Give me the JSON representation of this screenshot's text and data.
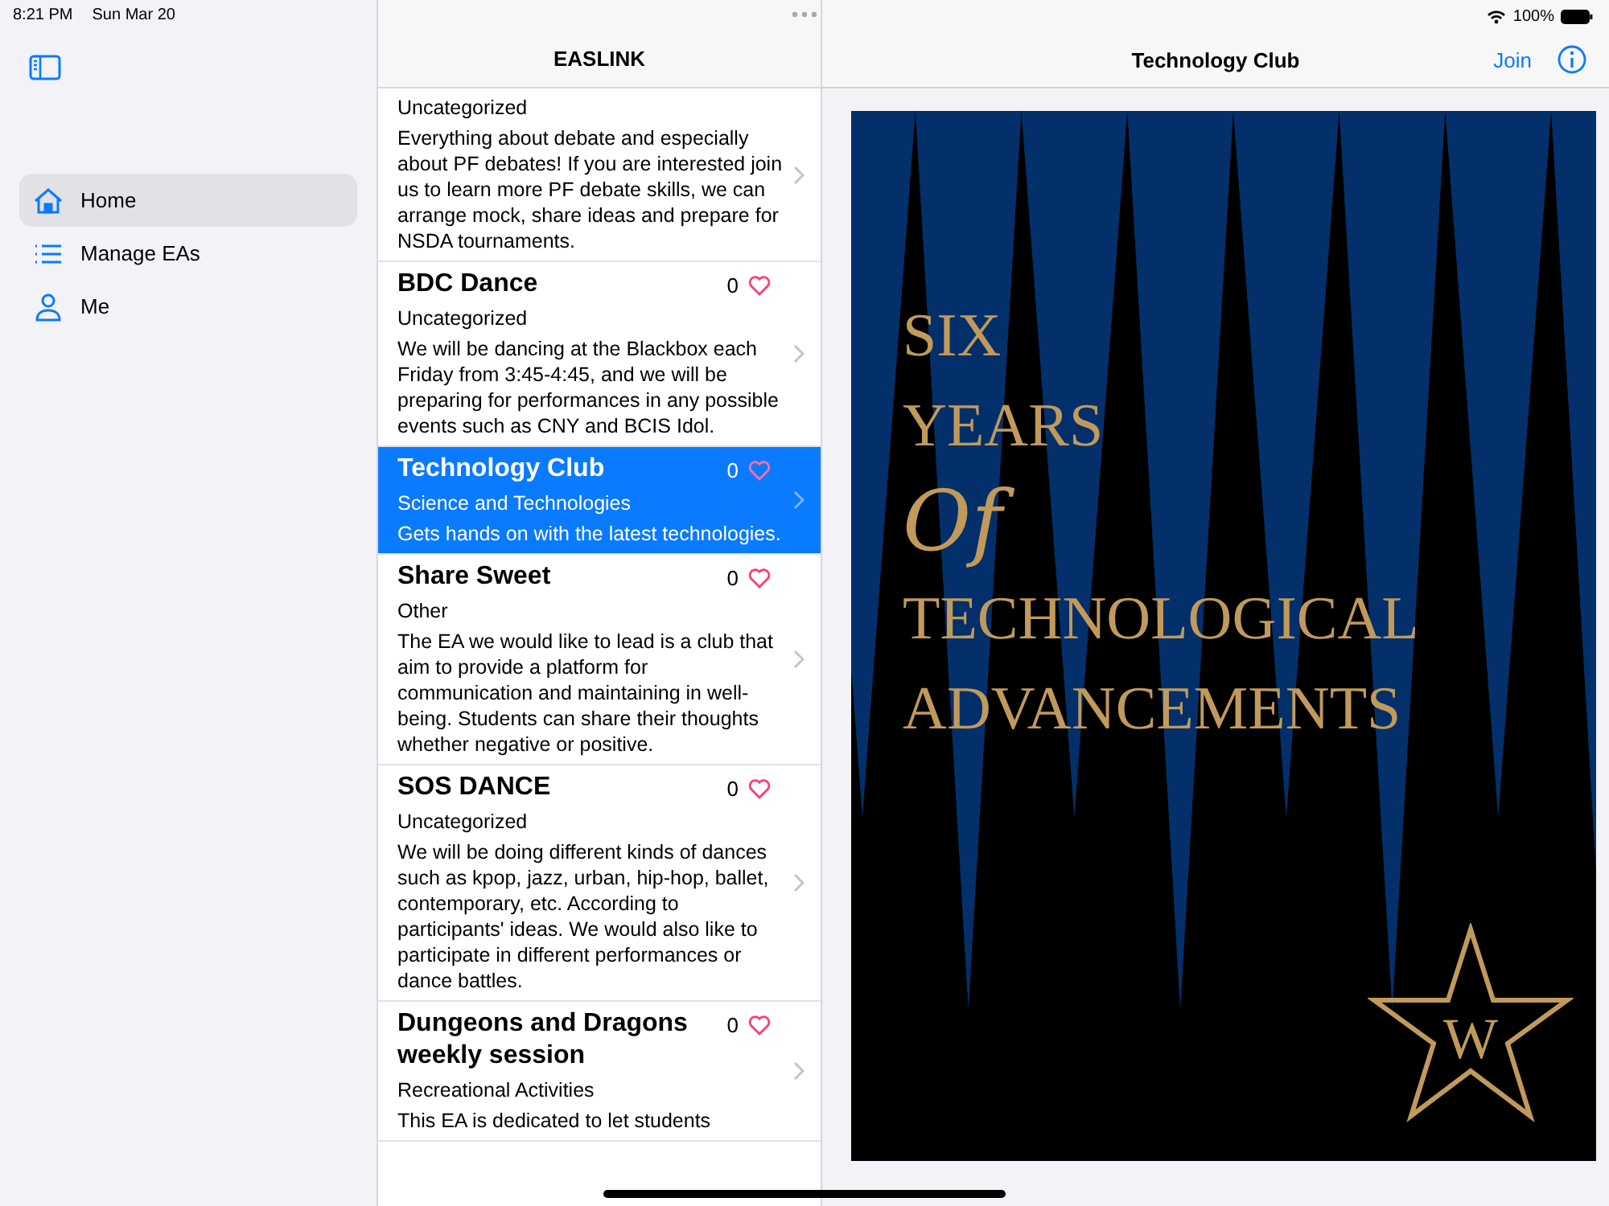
{
  "status_bar": {
    "time": "8:21 PM",
    "date": "Sun Mar 20",
    "battery": "100%"
  },
  "sidebar": {
    "items": [
      {
        "label": "Home",
        "kind": "home",
        "selected": true
      },
      {
        "label": "Manage EAs",
        "kind": "list",
        "selected": false
      },
      {
        "label": "Me",
        "kind": "person",
        "selected": false
      }
    ]
  },
  "list": {
    "title": "EASLINK",
    "items": [
      {
        "category": "Uncategorized",
        "description": "Everything about debate and especially about PF debates! If you are interested join us to learn more PF debate skills, we can arrange mock, share ideas and prepare for NSDA tournaments.",
        "selected": false
      },
      {
        "title": "BDC Dance",
        "count": "0",
        "category": "Uncategorized",
        "description": "We will be dancing at the Blackbox each Friday from 3:45-4:45, and we will be preparing for performances in any possible events such as CNY and BCIS Idol.",
        "selected": false
      },
      {
        "title": "Technology Club",
        "count": "0",
        "category": "Science and Technologies",
        "description": "Gets hands on with the latest technologies.",
        "selected": true
      },
      {
        "title": "Share Sweet",
        "count": "0",
        "category": "Other",
        "description": "The EA we would like to lead is a club that aim to provide a platform for communication and maintaining in well-being. Students can share their thoughts whether negative or positive.",
        "selected": false
      },
      {
        "title": "SOS DANCE",
        "count": "0",
        "category": "Uncategorized",
        "description": "We will be doing different kinds of dances such as kpop, jazz, urban, hip-hop, ballet, contemporary, etc. According to participants' ideas. We would also like to participate in different performances or dance battles.",
        "selected": false
      },
      {
        "title": "Dungeons and Dragons weekly session",
        "count": "0",
        "category": "Recreational Activities",
        "description": "This EA is dedicated to let students",
        "selected": false
      }
    ]
  },
  "detail": {
    "title": "Technology Club",
    "join": "Join",
    "poster": {
      "lines": [
        {
          "text": "SIX",
          "kind": "caps"
        },
        {
          "text": "YEARS",
          "kind": "caps"
        },
        {
          "text": "Of",
          "kind": "script"
        },
        {
          "text": "TECHNOLOGICAL",
          "kind": "caps"
        },
        {
          "text": "ADVANCEMENTS",
          "kind": "caps"
        }
      ],
      "emblem": "W"
    }
  }
}
